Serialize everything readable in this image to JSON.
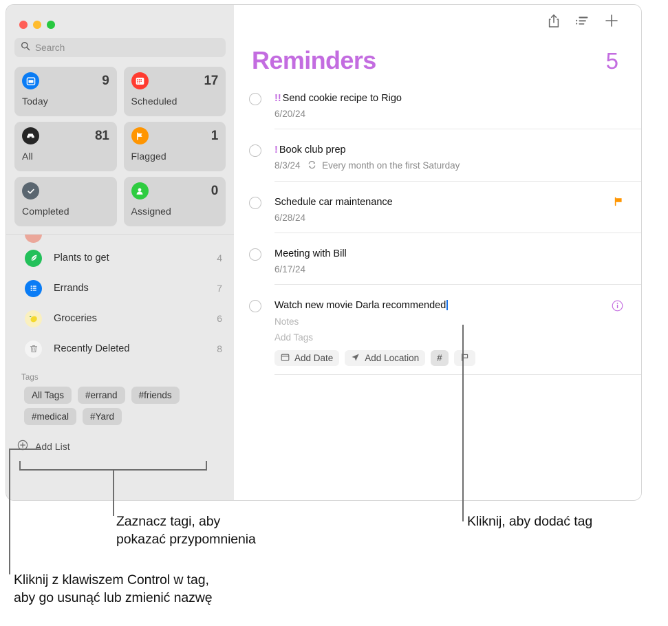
{
  "window": {
    "traffic_lights": [
      "close",
      "minimize",
      "zoom"
    ]
  },
  "sidebar": {
    "search": {
      "placeholder": "Search",
      "icon": "search-icon"
    },
    "smart_lists": [
      {
        "label": "Today",
        "count": "9",
        "icon": "calendar-today-icon",
        "color": "#0a7cf5"
      },
      {
        "label": "Scheduled",
        "count": "17",
        "icon": "calendar-scheduled-icon",
        "color": "#ff3b30"
      },
      {
        "label": "All",
        "count": "81",
        "icon": "inbox-all-icon",
        "color": "#262626"
      },
      {
        "label": "Flagged",
        "count": "1",
        "icon": "flag-icon",
        "color": "#ff9500"
      },
      {
        "label": "Completed",
        "count": "",
        "icon": "checkmark-icon",
        "color": "#5a6670"
      },
      {
        "label": "Assigned",
        "count": "0",
        "icon": "person-icon",
        "color": "#2ecc40"
      }
    ],
    "lists": [
      {
        "label": "Plants to get",
        "count": "4",
        "icon": "leaf-icon",
        "color": "#23c05a"
      },
      {
        "label": "Errands",
        "count": "7",
        "icon": "bullet-list-icon",
        "color": "#0a7cf5"
      },
      {
        "label": "Groceries",
        "count": "6",
        "icon": "lemon-icon",
        "color": "#faf0bf"
      },
      {
        "label": "Recently Deleted",
        "count": "8",
        "icon": "trash-icon",
        "color": "#f2f2f2"
      }
    ],
    "tags_header": "Tags",
    "tags": [
      "All Tags",
      "#errand",
      "#friends",
      "#medical",
      "#Yard"
    ],
    "add_list": {
      "label": "Add List",
      "icon": "plus-circle-icon"
    }
  },
  "toolbar": {
    "share_label": "share-icon",
    "sort_label": "list-sort-icon",
    "add_label": "plus-icon"
  },
  "main": {
    "title": "Reminders",
    "count": "5",
    "accent_color": "#c36ce0",
    "reminders": [
      {
        "priority": "!!",
        "title": "Send cookie recipe to Rigo",
        "date": "6/20/24",
        "repeat": "",
        "flagged": false
      },
      {
        "priority": "!",
        "title": "Book club prep",
        "date": "8/3/24",
        "repeat": "Every month on the first Saturday",
        "flagged": false
      },
      {
        "priority": "",
        "title": "Schedule car maintenance",
        "date": "6/28/24",
        "repeat": "",
        "flagged": true
      },
      {
        "priority": "",
        "title": "Meeting with Bill",
        "date": "6/17/24",
        "repeat": "",
        "flagged": false
      }
    ],
    "editing_reminder": {
      "title": "Watch new movie Darla recommended",
      "notes_placeholder": "Notes",
      "tags_placeholder": "Add Tags",
      "buttons": [
        {
          "label": "Add Date",
          "icon": "calendar-icon",
          "active": false
        },
        {
          "label": "Add Location",
          "icon": "location-arrow-icon",
          "active": false
        },
        {
          "label": "#",
          "icon": "hash-icon",
          "active": true
        },
        {
          "label": "",
          "icon": "flag-outline-icon",
          "active": false
        }
      ],
      "info_icon": "info-circle-icon"
    }
  },
  "callouts": [
    {
      "id": "tags-callout",
      "text_line_1": "Zaznacz tagi, aby",
      "text_line_2": "pokazać przypomnienia"
    },
    {
      "id": "add-tag-callout",
      "text_line_1": "Kliknij, aby dodać tag",
      "text_line_2": ""
    },
    {
      "id": "control-click-callout",
      "text_line_1": "Kliknij z klawiszem Control w tag,",
      "text_line_2": "aby go usunąć lub zmienić nazwę"
    }
  ]
}
